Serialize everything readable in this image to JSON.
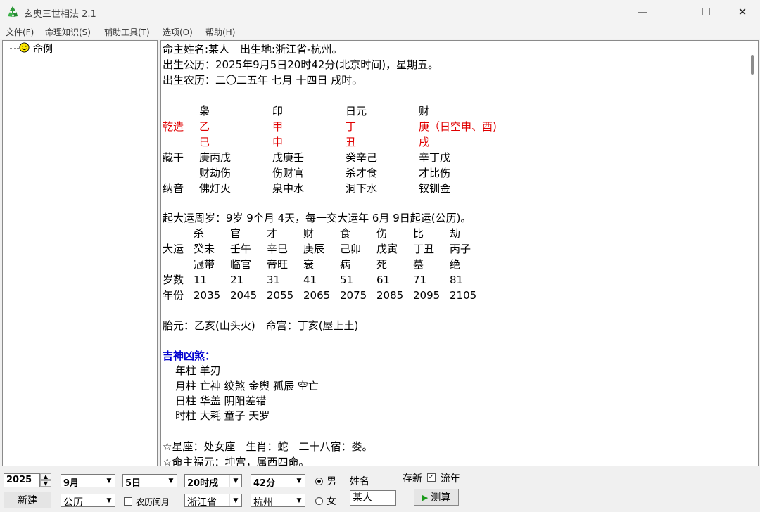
{
  "window": {
    "title": "玄奥三世相法 2.1",
    "minimize": "—",
    "maximize": "☐",
    "close": "✕"
  },
  "menu": [
    "文件(F)",
    "命理知识(S)",
    "辅助工具(T)",
    "选项(O)",
    "帮助(H)"
  ],
  "tree": {
    "root_label": "命例"
  },
  "content": {
    "l01": "命主姓名:某人　出生地:浙江省-杭州。",
    "l02": "出生公历：2025年9月5日20时42分(北京时间)，星期五。",
    "l03": "出生农历：二〇二五年 七月 十四日 戌时。",
    "shishen": [
      "枭",
      "印",
      "日元",
      "财"
    ],
    "qianzao": "乾造",
    "tiangan": [
      "乙",
      "甲",
      "丁",
      "庚（日空申、酉)"
    ],
    "dizhi": [
      "巳",
      "申",
      "丑",
      "戌"
    ],
    "canggan_label": "藏干",
    "canggan": [
      "庚丙戊",
      "戊庚壬",
      "癸辛己",
      "辛丁戊"
    ],
    "canggan_shen": [
      "财劫伤",
      "伤财官",
      "杀才食",
      "才比伤"
    ],
    "nayin_label": "纳音",
    "nayin": [
      "佛灯火",
      "泉中水",
      "洞下水",
      "钗钏金"
    ],
    "qiyun": "起大运周岁：9岁 9个月 4天，每一交大运年 6月 9日起运(公历)。",
    "dayun_shen": [
      "杀",
      "官",
      "才",
      "财",
      "食",
      "伤",
      "比",
      "劫"
    ],
    "dayun_label": "大运",
    "dayun": [
      "癸未",
      "壬午",
      "辛巳",
      "庚辰",
      "己卯",
      "戊寅",
      "丁丑",
      "丙子"
    ],
    "changsheng": [
      "冠带",
      "临官",
      "帝旺",
      "衰",
      "病",
      "死",
      "墓",
      "绝"
    ],
    "suishu_label": "岁数",
    "suishu": [
      "11",
      "21",
      "31",
      "41",
      "51",
      "61",
      "71",
      "81"
    ],
    "nianfen_label": "年份",
    "nianfen": [
      "2035",
      "2045",
      "2055",
      "2065",
      "2075",
      "2085",
      "2095",
      "2105"
    ],
    "taiyuan": "胎元：乙亥(山头火)　命宫：丁亥(屋上土)",
    "jishen_title": "吉神凶煞：",
    "jishen": [
      "年柱 羊刃",
      "月柱 亡神 绞煞 金舆 孤辰 空亡",
      "日柱 华盖 阴阳差错",
      "时柱 大耗 童子 天罗"
    ],
    "xingzuo": "☆星座：处女座　生肖：蛇　二十八宿：娄。",
    "fuyuan": "☆命主福元：坤宫，属西四命。"
  },
  "controls": {
    "year": "2025",
    "month": "9月",
    "day": "5日",
    "hour": "20时戌",
    "minute": "42分",
    "male_label": "男",
    "female_label": "女",
    "name_label": "姓名",
    "name_value": "某人",
    "save_label": "存新",
    "liunian_label": "流年",
    "liunian_checked": "✓",
    "new_label": "新建",
    "calendar": "公历",
    "leap_label": "农历闰月",
    "province": "浙江省",
    "city": "杭州",
    "calc_label": "测算"
  }
}
